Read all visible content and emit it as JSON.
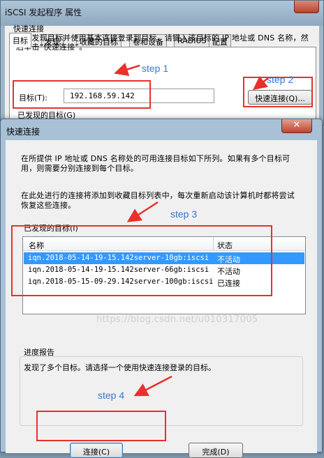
{
  "back_dialog": {
    "title": "iSCSI 发起程序 属性",
    "tabs": [
      "目标",
      "发现",
      "收藏的目标",
      "卷和设备",
      "RADIUS",
      "配置"
    ],
    "active_tab_index": 0,
    "group_label": "快速连接",
    "description": "若要发现目标并使用基本连接登录到目标，请键入该目标的 IP 地址或 DNS 名称，然后单击“快速连接”。",
    "target_label": "目标(T):",
    "target_value": "192.168.59.142",
    "quick_connect_button": "快速连接(Q)...",
    "discovered_label_peek": "已发现的目标(G)"
  },
  "quick_connect_dialog": {
    "title": "快速连接",
    "close_glyph": "✕",
    "paragraph_1": "在所提供 IP 地址或 DNS 名称处的可用连接目标如下所列。如果有多个目标可用，则需要分别连接到每个目标。",
    "paragraph_2": "在此处进行的连接将添加到收藏目标列表中，每次重新启动该计算机时都将尝试恢复这些连接。",
    "list_label": "已发现的目标(I)",
    "columns": [
      "名称",
      "状态"
    ],
    "targets": [
      {
        "name": "iqn.2018-05-14-19-15.142server-10gb:iscsi",
        "status": "不活动",
        "selected": true
      },
      {
        "name": "iqn.2018-05-14-19-15.142server-66gb:iscsi",
        "status": "不活动",
        "selected": false
      },
      {
        "name": "iqn.2018-05-15-09-29.142server-100gb:iscsi",
        "status": "已连接",
        "selected": false
      }
    ],
    "progress_label": "进度报告",
    "progress_text": "发现了多个目标。请选择一个使用快速连接登录的目标。",
    "connect_button": "连接(C)",
    "done_button": "完成(D)"
  },
  "annotations": {
    "step1": "step 1",
    "step2": "step 2",
    "step3": "step 3",
    "step4": "step 4",
    "color_red": "#e8312b",
    "color_blue": "#3a78c9"
  },
  "watermark": "https://blog.csdn.net/u010317005"
}
